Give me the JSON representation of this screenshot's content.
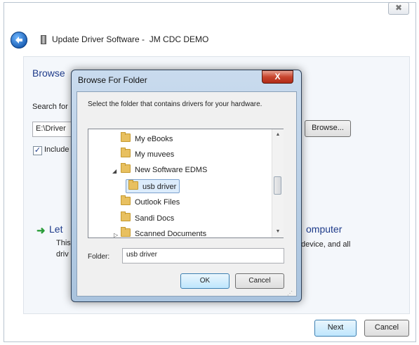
{
  "window": {
    "title": "Update Driver Software -  JM CDC DEMO",
    "close_glyph": "✖",
    "back_icon": "back-arrow-icon"
  },
  "main": {
    "heading": "Browse",
    "search_label": "Search for",
    "path_value": "E:\\Driver",
    "browse_button": "Browse...",
    "include_label": "Include",
    "include_checked": true,
    "option_let": "Let",
    "option_this": "This",
    "option_driv": "driv",
    "option_computer": "omputer",
    "option_device": "device, and all",
    "next_button": "Next",
    "cancel_button": "Cancel"
  },
  "dialog": {
    "title": "Browse For Folder",
    "close_glyph": "X",
    "instruction": "Select the folder that contains drivers for your hardware.",
    "tree": [
      {
        "label": "My eBooks",
        "expander": "",
        "selected": false
      },
      {
        "label": "My muvees",
        "expander": "",
        "selected": false
      },
      {
        "label": "New Software EDMS",
        "expander": "◢",
        "selected": false
      },
      {
        "label": "usb driver",
        "expander": "",
        "selected": true
      },
      {
        "label": "Outlook Files",
        "expander": "",
        "selected": false
      },
      {
        "label": "Sandi Docs",
        "expander": "",
        "selected": false
      },
      {
        "label": "Scanned Documents",
        "expander": "▷",
        "selected": false
      }
    ],
    "folder_label": "Folder:",
    "folder_value": "usb driver",
    "ok_button": "OK",
    "cancel_button": "Cancel"
  }
}
